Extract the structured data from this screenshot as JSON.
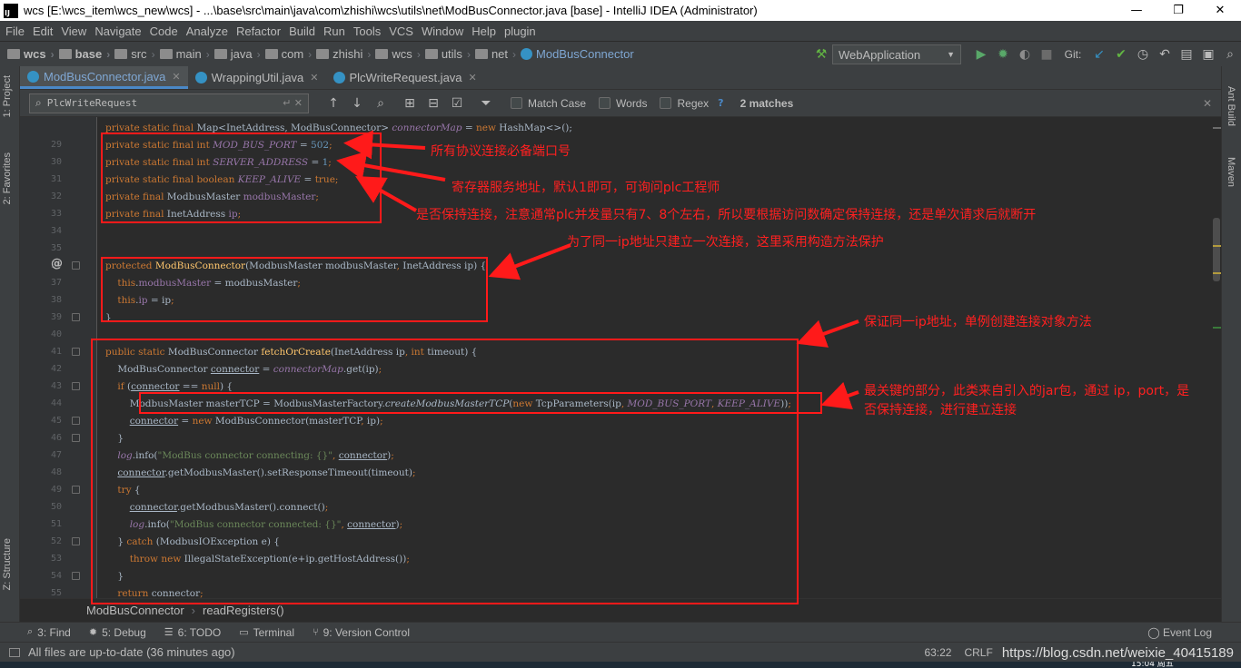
{
  "window": {
    "title": "wcs [E:\\wcs_item\\wcs_new\\wcs] - ...\\base\\src\\main\\java\\com\\zhishi\\wcs\\utils\\net\\ModBusConnector.java [base] - IntelliJ IDEA (Administrator)",
    "logo": "IJ",
    "controls": {
      "minimize": "—",
      "maximize": "❐",
      "close": "✕"
    }
  },
  "menu": [
    "File",
    "Edit",
    "View",
    "Navigate",
    "Code",
    "Analyze",
    "Refactor",
    "Build",
    "Run",
    "Tools",
    "VCS",
    "Window",
    "Help",
    "plugin"
  ],
  "breadcrumb": [
    "wcs",
    "base",
    "src",
    "main",
    "java",
    "com",
    "zhishi",
    "wcs",
    "utils",
    "net",
    "ModBusConnector"
  ],
  "toolbar": {
    "run_config": "WebApplication",
    "git_label": "Git:"
  },
  "left_tools": [
    "1: Project",
    "2: Favorites",
    "Z: Structure"
  ],
  "right_tools": [
    "Ant Build",
    "Maven"
  ],
  "tabs": [
    {
      "label": "ModBusConnector.java",
      "active": true
    },
    {
      "label": "WrappingUtil.java",
      "active": false
    },
    {
      "label": "PlcWriteRequest.java",
      "active": false
    }
  ],
  "find": {
    "query": "PlcWriteRequest",
    "match_case": "Match Case",
    "words": "Words",
    "regex": "Regex",
    "help": "?",
    "matches": "2 matches"
  },
  "code_lines": [
    {
      "n": "",
      "t": "partial"
    },
    {
      "n": "29"
    },
    {
      "n": "30"
    },
    {
      "n": "31"
    },
    {
      "n": "32"
    },
    {
      "n": "33"
    },
    {
      "n": "34"
    },
    {
      "n": "35"
    },
    {
      "n": "36"
    },
    {
      "n": "37"
    },
    {
      "n": "38"
    },
    {
      "n": "39"
    },
    {
      "n": "40"
    },
    {
      "n": "41"
    },
    {
      "n": "42"
    },
    {
      "n": "43"
    },
    {
      "n": "44"
    },
    {
      "n": "45"
    },
    {
      "n": "46"
    },
    {
      "n": "47"
    },
    {
      "n": "48"
    },
    {
      "n": "49"
    },
    {
      "n": "50"
    },
    {
      "n": "51"
    },
    {
      "n": "52"
    },
    {
      "n": "53"
    },
    {
      "n": "54"
    },
    {
      "n": "55"
    }
  ],
  "annotations": {
    "a1": "所有协议连接必备端口号",
    "a2": "寄存器服务地址，默认1即可，可询问plc工程师",
    "a3": "是否保持连接，注意通常plc并发量只有7、8个左右，所以要根据访问数确定保持连接，还是单次请求后就断开",
    "a4": "为了同一ip地址只建立一次连接，这里采用构造方法保护",
    "a5": "保证同一ip地址，单例创建连接对象方法",
    "a6_line1": "最关键的部分，此类来自引入的jar包，通过 ip，port，是",
    "a6_line2": "否保持连接，进行建立连接"
  },
  "editor_breadcrumb": [
    "ModBusConnector",
    "readRegisters()"
  ],
  "bottom_tools": [
    {
      "icon": "search-icon",
      "label": "3: Find"
    },
    {
      "icon": "bug-icon",
      "label": "5: Debug"
    },
    {
      "icon": "todo-icon",
      "label": "6: TODO"
    },
    {
      "icon": "terminal-icon",
      "label": "Terminal"
    },
    {
      "icon": "vcs-icon",
      "label": "9: Version Control"
    }
  ],
  "event_log": "Event Log",
  "status": {
    "message": "All files are up-to-date (36 minutes ago)",
    "position": "63:22",
    "line_sep": "CRLF",
    "watermark": "https://blog.csdn.net/weixie_40415189"
  },
  "taskbar_clock": "15:04 周五",
  "colors": {
    "annotation": "#ff1a1a",
    "keyword": "#cc7832",
    "field": "#9876aa",
    "number": "#6897bb",
    "string": "#6a8759",
    "method": "#ffc66d",
    "accent": "#4a88c7"
  }
}
